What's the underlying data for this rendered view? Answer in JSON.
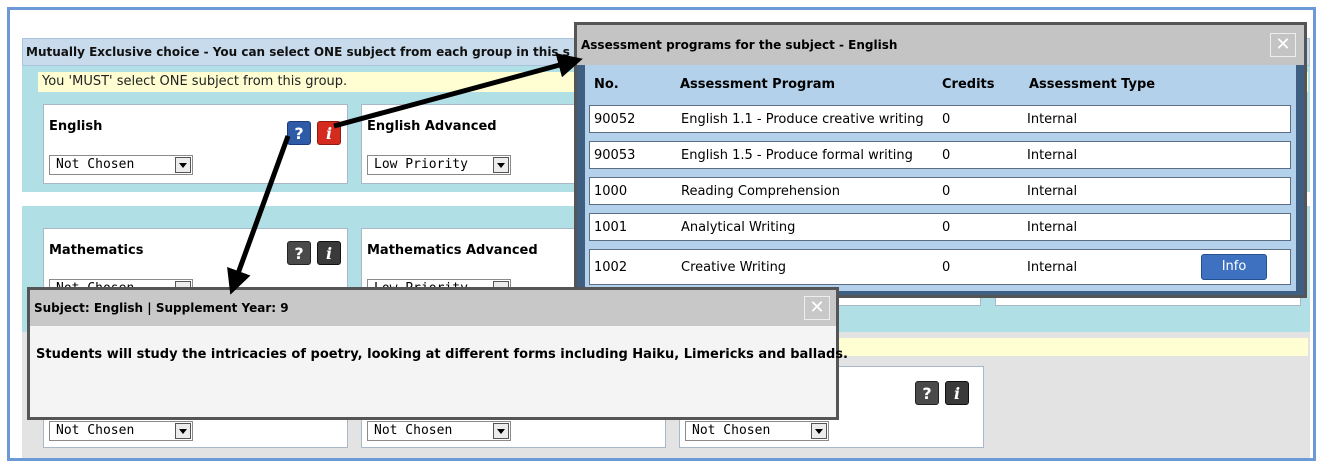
{
  "group": {
    "header": "Mutually Exclusive choice - You can select ONE subject from each group in this s",
    "notice": "You 'MUST' select ONE subject from this group."
  },
  "cards": {
    "english": {
      "title": "English",
      "select": "Not Chosen"
    },
    "english_adv": {
      "title": "English Advanced",
      "select": "Low Priority"
    },
    "math": {
      "title": "Mathematics",
      "select": "Not Chosen"
    },
    "math_adv": {
      "title": "Mathematics Advanced",
      "select": "Low Priority"
    },
    "row3": {
      "select1": "Not Chosen",
      "select2": "Not Chosen",
      "select3": "Not Chosen"
    }
  },
  "icons": {
    "help": "?",
    "info": "i"
  },
  "assessment_popup": {
    "title": "Assessment programs for the subject - English",
    "close": "✕",
    "headers": {
      "no": "No.",
      "program": "Assessment Program",
      "credits": "Credits",
      "type": "Assessment Type"
    },
    "rows": [
      {
        "no": "90052",
        "program": "English 1.1 - Produce creative writing",
        "credits": "0",
        "type": "Internal"
      },
      {
        "no": "90053",
        "program": "English 1.5 - Produce formal writing",
        "credits": "0",
        "type": "Internal"
      },
      {
        "no": "1000",
        "program": "Reading Comprehension",
        "credits": "0",
        "type": "Internal"
      },
      {
        "no": "1001",
        "program": "Analytical Writing",
        "credits": "0",
        "type": "Internal"
      },
      {
        "no": "1002",
        "program": "Creative Writing",
        "credits": "0",
        "type": "Internal"
      }
    ],
    "info_label": "Info"
  },
  "supplement_popup": {
    "title": "Subject: English | Supplement Year: 9",
    "close": "✕",
    "text": "Students will study the intricacies of poetry, looking at different forms including Haiku, Limericks and ballads."
  }
}
